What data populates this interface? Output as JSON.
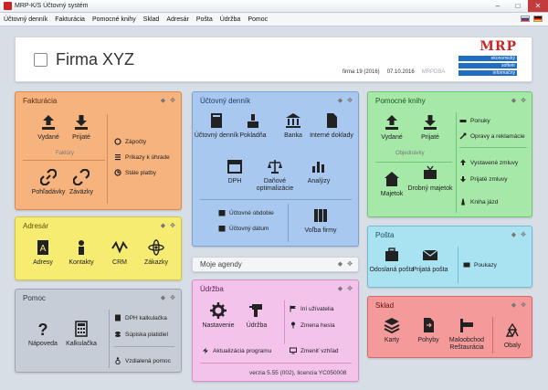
{
  "window": {
    "title": "MRP-K/S Účtovný systém"
  },
  "menu": [
    "Účtovný denník",
    "Fakturácia",
    "Pomocné knihy",
    "Sklad",
    "Adresár",
    "Pošta",
    "Údržba",
    "Pomoc"
  ],
  "header": {
    "company": "Firma XYZ",
    "firm_info": "firma 19 (2016)",
    "date": "07.10.2016",
    "db": "MRPDBA",
    "logo_text": "MRP",
    "logo_lines": [
      "ekonomický",
      "softvér",
      "informačný"
    ]
  },
  "fakturacia": {
    "title": "Fakturácia",
    "tiles": [
      "Vydané",
      "Prijaté",
      "Pohľadávky",
      "Záväzky"
    ],
    "subtitle": "Faktúry",
    "links": [
      "Zápočty",
      "Príkazy k úhrade",
      "Stále platby"
    ]
  },
  "ucetny": {
    "title": "Účtovný denník",
    "tiles": [
      "Účtovný denník",
      "Pokladňa",
      "Banka",
      "Interné doklady",
      "DPH",
      "Daňové optimalizácie",
      "Analýzy"
    ],
    "links": [
      "Účtovné obdobie",
      "Účtovný dátum"
    ],
    "tile_bottom": "Voľba firmy"
  },
  "pomocne": {
    "title": "Pomocné knihy",
    "tiles": [
      "Vydané",
      "Prijaté",
      "Majetok",
      "Drobný majetok"
    ],
    "subtitle": "Objednávky",
    "links": [
      "Ponuky",
      "Opravy a reklamácie",
      "Vystavené zmluvy",
      "Prijaté zmluvy",
      "Kniha jázd"
    ]
  },
  "adresar": {
    "title": "Adresár",
    "tiles": [
      "Adresy",
      "Kontakty",
      "CRM",
      "Zákazky"
    ]
  },
  "moje": {
    "title": "Moje agendy"
  },
  "posta": {
    "title": "Pošta",
    "tiles": [
      "Odoslaná pošta",
      "Prijatá pošta"
    ],
    "links": [
      "Poukazy"
    ]
  },
  "pomoc": {
    "title": "Pomoc",
    "tiles": [
      "Nápoveda",
      "Kalkulačka"
    ],
    "links": [
      "DPH kalkulačka",
      "Súpiska platidiel",
      "Vzdialená pomoc"
    ]
  },
  "udrzba": {
    "title": "Údržba",
    "tiles": [
      "Nastavenie",
      "Údržba"
    ],
    "links": [
      "Iní užívatelia",
      "Zmena hesla",
      "Aktualizácia programu",
      "Zmeniť vzhľad"
    ],
    "version": "verzia 5.55 (002), licencia YC050008"
  },
  "sklad": {
    "title": "Sklad",
    "tiles": [
      "Karty",
      "Pohyby",
      "Maloobchod Reštaurácia",
      "Obaly"
    ]
  },
  "colors": {
    "fakt": "#f6b37d",
    "ucet": "#a8c8ef",
    "pom": "#a5e8a8",
    "adr": "#f6ec72",
    "posta": "#a9e2f1",
    "pomoc": "#c7cdd6",
    "udrz": "#f4c3ec",
    "sklad": "#f59a9a"
  }
}
